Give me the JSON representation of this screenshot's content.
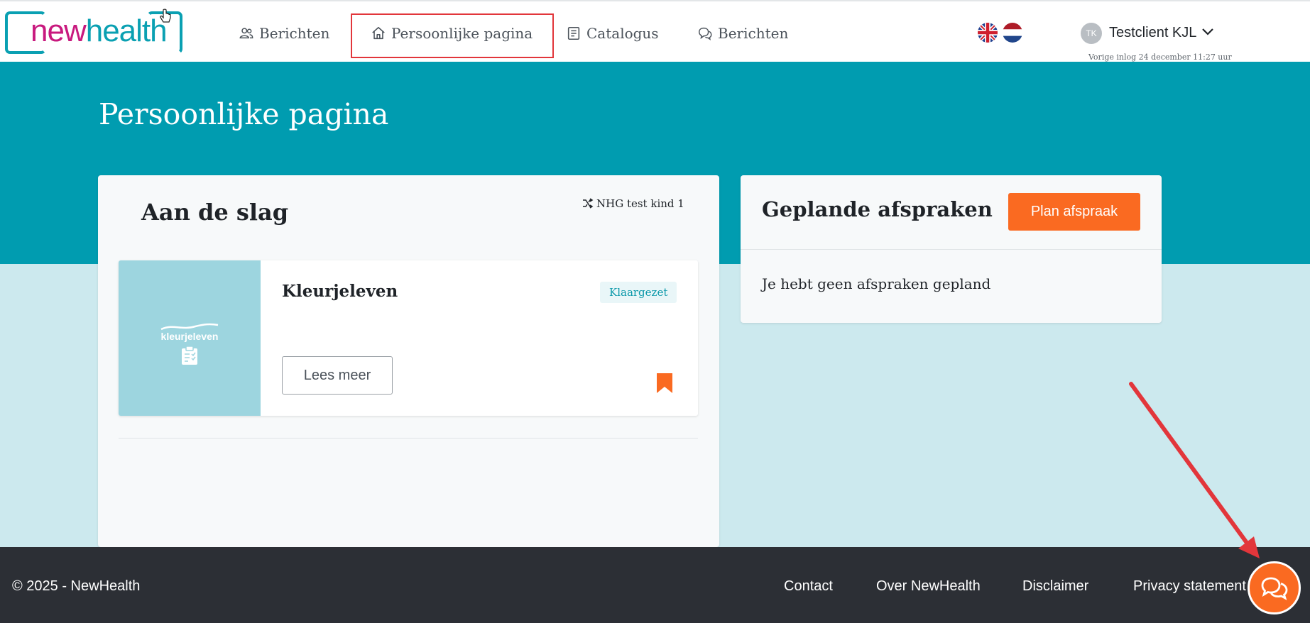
{
  "brand": {
    "logo_part1": "new",
    "logo_part2": "health"
  },
  "nav": {
    "items": [
      {
        "label": "Berichten",
        "icon": "users-icon"
      },
      {
        "label": "Persoonlijke pagina",
        "icon": "home-icon"
      },
      {
        "label": "Catalogus",
        "icon": "book-icon"
      },
      {
        "label": "Berichten",
        "icon": "chat-icon"
      }
    ]
  },
  "languages": [
    "English",
    "Nederlands"
  ],
  "user": {
    "initials": "TK",
    "name": "Testclient KJL",
    "last_login": "Vorige inlog 24 december 11:27 uur"
  },
  "page": {
    "title": "Persoonlijke pagina"
  },
  "getting_started": {
    "title": "Aan de slag",
    "child_selector": "NHG test kind 1",
    "module": {
      "image_brand": "kleurjeleven",
      "title": "Kleurjeleven",
      "status": "Klaargezet",
      "button": "Lees meer"
    }
  },
  "appointments": {
    "title": "Geplande afspraken",
    "plan_button": "Plan afspraak",
    "empty_text": "Je hebt geen afspraken gepland"
  },
  "footer": {
    "copyright": "© 2025 - NewHealth",
    "links": [
      "Contact",
      "Over NewHealth",
      "Disclaimer",
      "Privacy statement"
    ]
  },
  "colors": {
    "teal": "#009cb0",
    "light_teal": "#cce9ee",
    "orange": "#fa6a21",
    "magenta": "#c8197e",
    "footer": "#2c2f35",
    "annotation_red": "#e2363b"
  }
}
